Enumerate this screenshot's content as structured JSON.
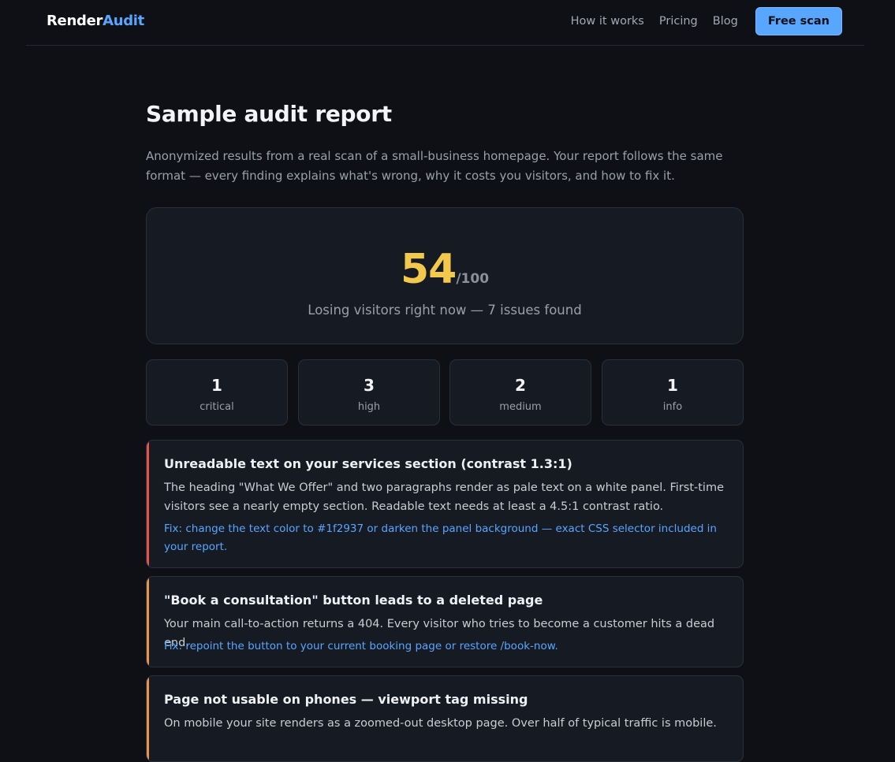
{
  "nav": {
    "logo_part1": "Render",
    "logo_part2": "Audit",
    "links": [
      "How it works",
      "Pricing",
      "Blog"
    ],
    "cta_label": "Free scan"
  },
  "page": {
    "title": "Sample audit report",
    "lead": "Anonymized results from a real scan of a small-business homepage. Your report follows the same format — every finding explains what's wrong, why it costs you visitors, and how to fix it."
  },
  "score": {
    "value": "54",
    "denominator": "/100",
    "summary": "Losing visitors right now — 7 issues found"
  },
  "stats": [
    {
      "count": "1",
      "label": "critical"
    },
    {
      "count": "3",
      "label": "high"
    },
    {
      "count": "2",
      "label": "medium"
    },
    {
      "count": "1",
      "label": "info"
    }
  ],
  "findings": [
    {
      "severity_color": "#e5534b",
      "title": "Unreadable text on your services section (contrast 1.3:1)",
      "body": "The heading \"What We Offer\" and two paragraphs render as pale text on a white panel. First-time visitors see a nearly empty section. Readable text needs at least a 4.5:1 contrast ratio.",
      "fix": "Fix: change the text color to #1f2937 or darken the panel background — exact CSS selector included in your report."
    },
    {
      "severity_color": "#e8944a",
      "title": "\"Book a consultation\" button leads to a deleted page",
      "body": "Your main call-to-action returns a 404. Every visitor who tries to become a customer hits a dead end.",
      "fix": "Fix: repoint the button to your current booking page or restore /book-now."
    },
    {
      "severity_color": "#e8944a",
      "title": "Page not usable on phones — viewport tag missing",
      "body": "On mobile your site renders as a zoomed-out desktop page. Over half of typical traffic is mobile.",
      "fix": ""
    }
  ]
}
